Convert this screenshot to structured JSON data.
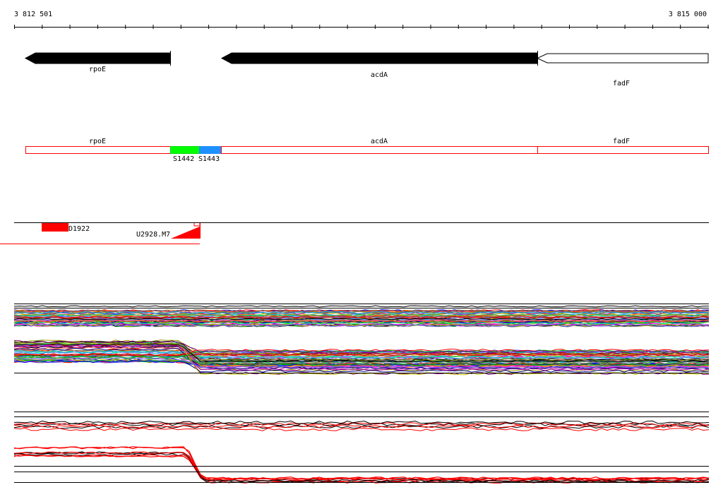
{
  "ruler": {
    "start_label": "3 812 501",
    "end_label": "3 815 000"
  },
  "genes": [
    {
      "name": "rpoE",
      "strand": "-",
      "style": "filled"
    },
    {
      "name": "acdA",
      "strand": "-",
      "style": "filled"
    },
    {
      "name": "fadF",
      "strand": "-",
      "style": "outline"
    }
  ],
  "segments": [
    {
      "label": "rpoE",
      "color": "#ffffff"
    },
    {
      "label": "S1442",
      "color": "#00ff00"
    },
    {
      "label": "S1443",
      "color": "#1e90ff"
    },
    {
      "label": "acdA",
      "color": "#ffffff"
    },
    {
      "label": "fadF",
      "color": "#ffffff"
    }
  ],
  "features": [
    {
      "label": "D1922",
      "color": "#ff0000"
    },
    {
      "label": "U2928.M7",
      "color": "#ff0000"
    }
  ],
  "colors": {
    "segment_border": "#ff0000",
    "highlight_trace": "#ff0000",
    "axis": "#000000"
  }
}
